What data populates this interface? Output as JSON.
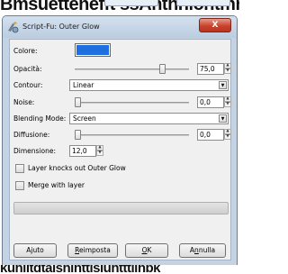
{
  "background": {
    "top_text": "Bmsuettenefft ssAnthnlontmnllenn",
    "bottom_text": "kuhiitdtaishinttisluhtttiihbk"
  },
  "window": {
    "title": "Script-Fu: Outer Glow",
    "close_glyph": "X"
  },
  "fields": {
    "colore": {
      "label": "Colore:",
      "color": "#1e6fe0"
    },
    "opacita": {
      "label": "Opacità:",
      "value": "75,0",
      "level": 0.75
    },
    "contour": {
      "label": "Contour:",
      "selected": "Linear"
    },
    "noise": {
      "label": "Noise:",
      "value": "0,0",
      "level": 0.0
    },
    "blending_mode": {
      "label": "Blending Mode:",
      "selected": "Screen"
    },
    "diffusione": {
      "label": "Diffusione:",
      "value": "0,0",
      "level": 0.0
    },
    "dimensione": {
      "label": "Dimensione:",
      "value": "12,0"
    }
  },
  "checkboxes": {
    "layer_knocks_out": {
      "label": "Layer knocks out Outer Glow",
      "checked": false
    },
    "merge_with_layer": {
      "label": "Merge with layer",
      "checked": false
    }
  },
  "buttons": {
    "ajuto": {
      "label": "Ajuto"
    },
    "reimposta": {
      "mnemonic": "R",
      "rest": "eimposta"
    },
    "ok": {
      "mnemonic": "O",
      "rest": "K"
    },
    "annulla": {
      "prefix": "A",
      "mnemonic": "n",
      "rest": "nulla"
    }
  },
  "icons": {
    "window_icon": "script-fu-icon",
    "dropdown_arrow": "chevron-down-icon",
    "spin_up": "spin-up-icon",
    "spin_down": "spin-down-icon"
  }
}
